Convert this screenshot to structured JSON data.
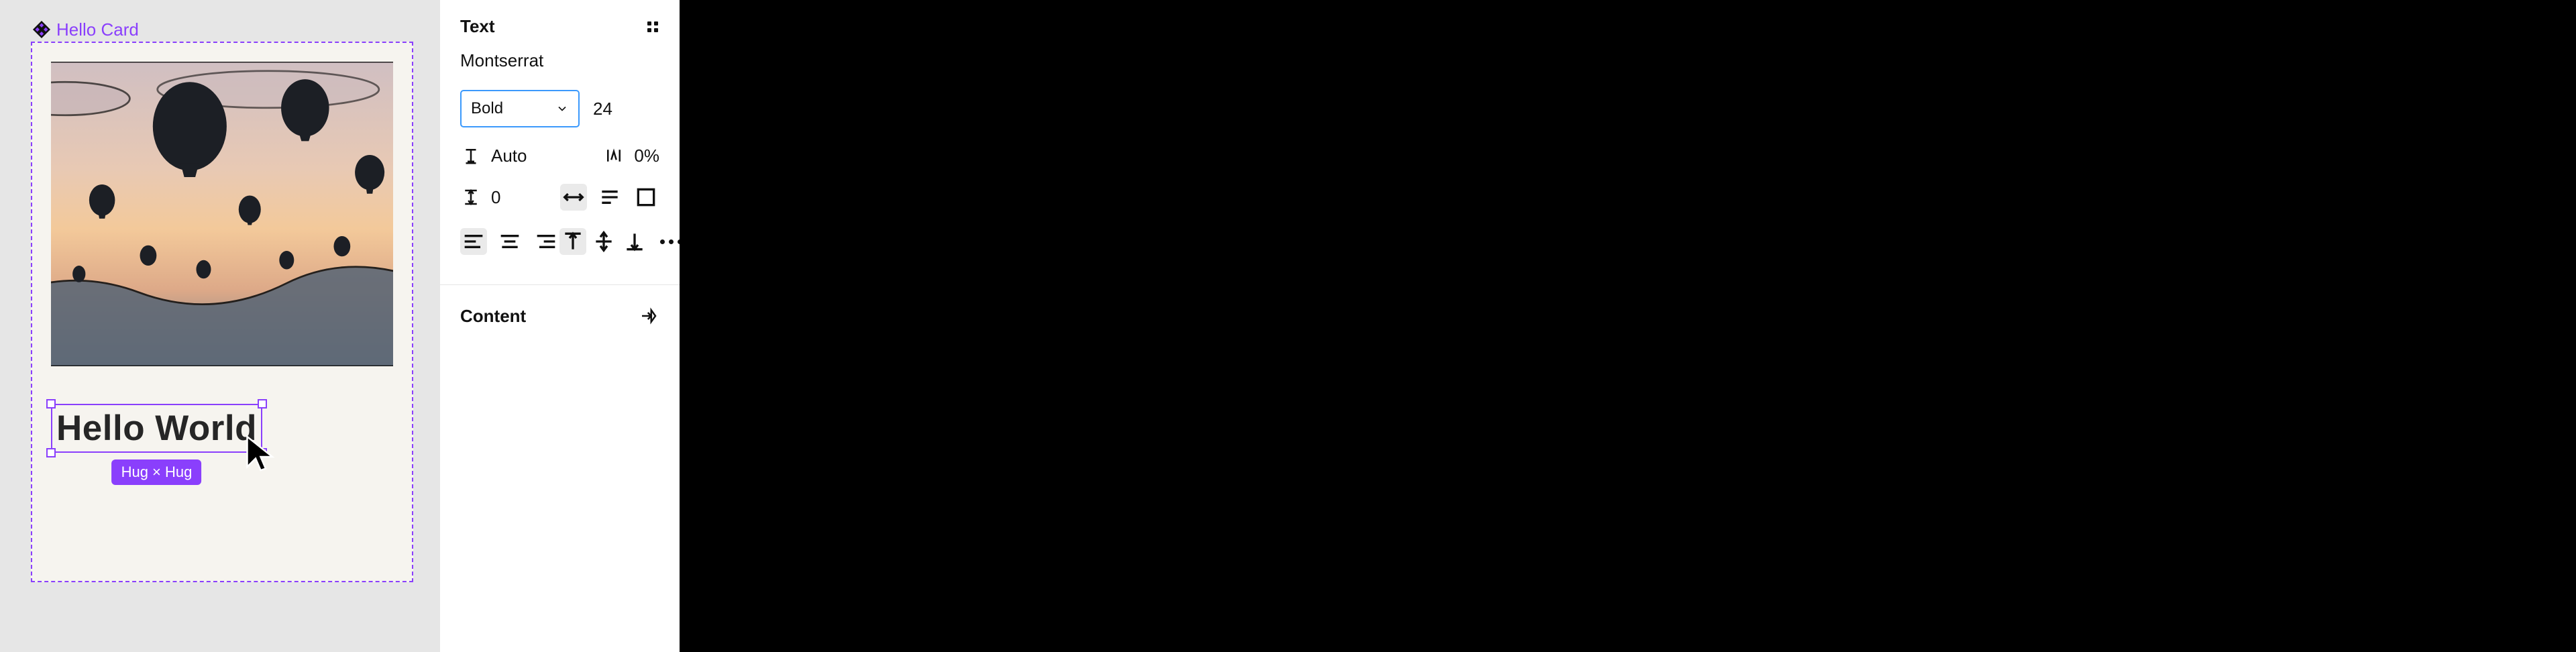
{
  "canvas": {
    "frame_label": "Hello Card",
    "text_content": "Hello World",
    "size_badge": "Hug × Hug"
  },
  "panel": {
    "text": {
      "header": "Text",
      "font_family": "Montserrat",
      "font_weight": "Bold",
      "font_size": "24",
      "line_height": "Auto",
      "letter_spacing": "0%",
      "paragraph_spacing": "0"
    },
    "content": {
      "header": "Content"
    }
  }
}
